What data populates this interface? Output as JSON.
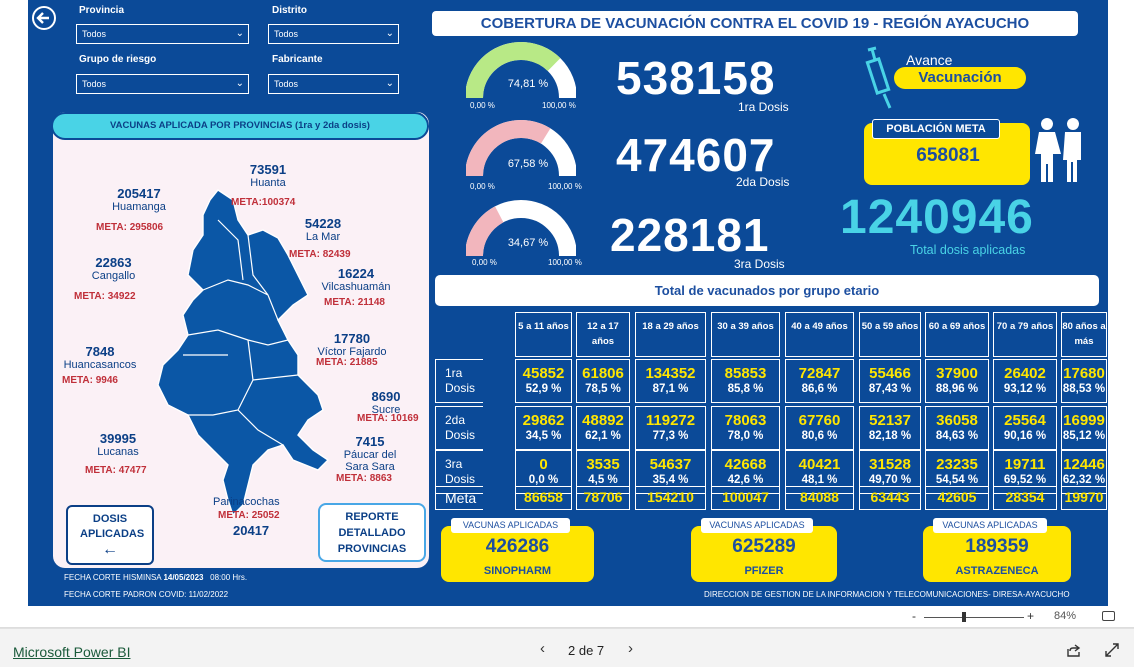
{
  "filters": {
    "provincia": {
      "label": "Provincia",
      "value": "Todos"
    },
    "distrito": {
      "label": "Distrito",
      "value": "Todos"
    },
    "grupo_riesgo": {
      "label": "Grupo de riesgo",
      "value": "Todos"
    },
    "fabricante": {
      "label": "Fabricante",
      "value": "Todos"
    }
  },
  "title": "COBERTURA DE VACUNACIÓN CONTRA EL COVID 19 - REGIÓN AYACUCHO",
  "gauges": [
    {
      "pct_label": "74,81 %",
      "pct": 74.81,
      "min": "0,00 %",
      "max": "100,00 %",
      "color": "#b8e986"
    },
    {
      "pct_label": "67,58 %",
      "pct": 67.58,
      "min": "0,00 %",
      "max": "100,00 %",
      "color": "#f2b6bd"
    },
    {
      "pct_label": "34,67 %",
      "pct": 34.67,
      "min": "0,00 %",
      "max": "100,00 %",
      "color": "#f2b6bd"
    }
  ],
  "doses": [
    {
      "value": "538158",
      "label": "1ra Dosis"
    },
    {
      "value": "474607",
      "label": "2da Dosis"
    },
    {
      "value": "228181",
      "label": "3ra Dosis"
    }
  ],
  "avance": {
    "line1": "Avance",
    "line2": "Vacunación"
  },
  "poblacion": {
    "label": "POBLACIÓN META",
    "value": "658081"
  },
  "total": {
    "value": "1240946",
    "label": "Total dosis aplicadas"
  },
  "map_panel": {
    "title": "VACUNAS APLICADA POR PROVINCIAS (1ra y 2da dosis)"
  },
  "provinces": {
    "huanta": {
      "num": "73591",
      "name": "Huanta",
      "meta_label": "META:",
      "meta": "100374"
    },
    "huamanga": {
      "num": "205417",
      "name": "Huamanga",
      "meta_label": "META:",
      "meta": "295806"
    },
    "lamar": {
      "num": "54228",
      "name": "La Mar",
      "meta_label": "META:",
      "meta": "82439"
    },
    "cangallo": {
      "num": "22863",
      "name": "Cangallo",
      "meta_label": "META:",
      "meta": "34922"
    },
    "vilcas": {
      "num": "16224",
      "name": "Vilcashuamán",
      "meta_label": "META:",
      "meta": "21148"
    },
    "fajardo": {
      "num": "17780",
      "name": "Víctor Fajardo",
      "meta_label": "META:",
      "meta": "21885"
    },
    "huancasancos": {
      "num": "7848",
      "name": "Huancasancos",
      "meta_label": "META:",
      "meta": "9946"
    },
    "sucre": {
      "num": "8690",
      "name": "Sucre",
      "meta_label": "META:",
      "meta": "10169"
    },
    "lucanas": {
      "num": "39995",
      "name": "Lucanas",
      "meta_label": "META:",
      "meta": "47477"
    },
    "paucar": {
      "num": "7415",
      "name": "Páucar del",
      "name2": "Sara Sara",
      "meta_label": "META:",
      "meta": "8863"
    },
    "parinacochas": {
      "num": "20417",
      "name": "Parinacochas",
      "meta_label": "META:",
      "meta": "25052"
    }
  },
  "buttons": {
    "dosis": "DOSIS APLICADAS",
    "reporte": "REPORTE DETALLADO PROVINCIAS"
  },
  "fechas": {
    "corte1_label": "FECHA CORTE HISMINSA",
    "corte1_date": "14/05/2023",
    "corte1_time": "08:00 Hrs.",
    "corte2": "FECHA CORTE PADRON COVID: 11/02/2022"
  },
  "age_table": {
    "title": "Total de vacunados por grupo etario",
    "headers": [
      "5 a 11 años",
      "12 a 17 años",
      "18 a 29 años",
      "30 a 39 años",
      "40 a 49 años",
      "50 a 59 años",
      "60 a 69 años",
      "70 a 79 años",
      "80 años a más"
    ],
    "rows": [
      {
        "label1": "1ra",
        "label2": "Dosis",
        "values": [
          "45852",
          "61806",
          "134352",
          "85853",
          "72847",
          "55466",
          "37900",
          "26402",
          "17680"
        ],
        "pcts": [
          "52,9 %",
          "78,5 %",
          "87,1 %",
          "85,8 %",
          "86,6 %",
          "87,43 %",
          "88,96 %",
          "93,12 %",
          "88,53 %"
        ]
      },
      {
        "label1": "2da",
        "label2": "Dosis",
        "values": [
          "29862",
          "48892",
          "119272",
          "78063",
          "67760",
          "52137",
          "36058",
          "25564",
          "16999"
        ],
        "pcts": [
          "34,5 %",
          "62,1 %",
          "77,3 %",
          "78,0 %",
          "80,6 %",
          "82,18 %",
          "84,63 %",
          "90,16 %",
          "85,12 %"
        ]
      },
      {
        "label1": "3ra",
        "label2": "Dosis",
        "values": [
          "0",
          "3535",
          "54637",
          "42668",
          "40421",
          "31528",
          "23235",
          "19711",
          "12446"
        ],
        "pcts": [
          "0,0 %",
          "4,5 %",
          "35,4 %",
          "42,6 %",
          "48,1 %",
          "49,70 %",
          "54,54 %",
          "69,52 %",
          "62,32 %"
        ]
      }
    ],
    "meta_label": "Meta",
    "meta_values": [
      "86658",
      "78706",
      "154210",
      "100047",
      "84088",
      "63443",
      "42605",
      "28354",
      "19970"
    ]
  },
  "vaccines": [
    {
      "header": "VACUNAS APLICADAS",
      "value": "426286",
      "name": "SINOPHARM"
    },
    {
      "header": "VACUNAS APLICADAS",
      "value": "625289",
      "name": "PFIZER"
    },
    {
      "header": "VACUNAS APLICADAS",
      "value": "189359",
      "name": "ASTRAZENECA"
    }
  ],
  "credit": "DIRECCION DE GESTION DE LA INFORMACION Y TELECOMUNICACIONES- DIRESA-AYACUCHO",
  "zoom": {
    "minus": "-",
    "plus": "+",
    "value": "84%"
  },
  "app": {
    "name": "Microsoft Power BI",
    "page": "2 de 7"
  },
  "colors": {
    "background": "#0b4a98",
    "accent": "#ffe600",
    "light_blue": "#49d3e6",
    "pink": "#f2b6bd",
    "green": "#b8e986"
  }
}
